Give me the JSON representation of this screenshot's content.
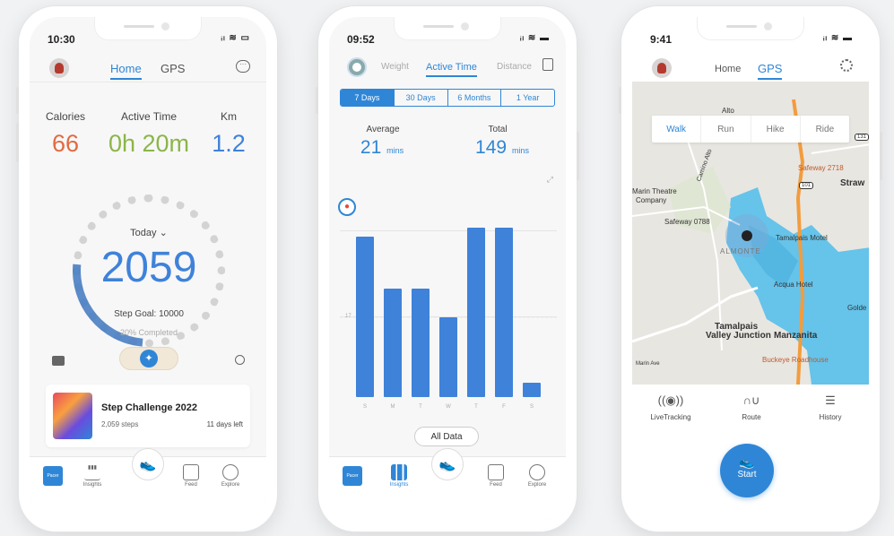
{
  "colors": {
    "accent": "#2f86d6",
    "calories": "#e16a40",
    "active_time": "#8cb54a",
    "km": "#3f82d9",
    "bar": "#3f82d9"
  },
  "phone1": {
    "status": {
      "time": "10:30",
      "icons": "ᵢₗ ≋ ▭"
    },
    "tabs": [
      "Home",
      "GPS"
    ],
    "metrics": [
      {
        "label": "Calories",
        "value": "66"
      },
      {
        "label": "Active Time",
        "value": "0h 20m"
      },
      {
        "label": "Km",
        "value": "1.2"
      }
    ],
    "day_selector": "Today ⌄",
    "steps": "2059",
    "step_goal": "Step Goal: 10000",
    "completed": "20% Completed",
    "progress_fraction": 0.2,
    "challenge": {
      "title": "Step Challenge 2022",
      "steps": "2,059 steps",
      "days_left": "11 days left"
    },
    "nav": {
      "logo": "Pacer",
      "insights": "Insights",
      "feed": "Feed",
      "explore": "Explore"
    }
  },
  "phone2": {
    "status": {
      "time": "09:52",
      "icons": "ᵢₗ ≋ ▬"
    },
    "tabs": [
      "Weight",
      "Active Time",
      "Distance"
    ],
    "ranges": [
      "7 Days",
      "30 Days",
      "6 Months",
      "1 Year"
    ],
    "average_label": "Average",
    "average_value": "21",
    "total_label": "Total",
    "total_value": "149",
    "unit": "mins",
    "y_marker": "17",
    "all_data": "All Data",
    "nav": {
      "logo": "Pacer",
      "insights": "Insights",
      "feed": "Feed",
      "explore": "Explore"
    }
  },
  "chart_data": {
    "type": "bar",
    "categories": [
      "S",
      "M",
      "T",
      "W",
      "T",
      "F",
      "S"
    ],
    "values": [
      34,
      23,
      23,
      17,
      36,
      36,
      3
    ],
    "ylabel": "",
    "reference_line": 17
  },
  "phone3": {
    "status": {
      "time": "9:41",
      "icons": "ᵢₗ ≋ ▬"
    },
    "tabs": [
      "Home",
      "GPS"
    ],
    "modes": [
      "Walk",
      "Run",
      "Hike",
      "Ride"
    ],
    "map_labels": {
      "alto": "Alto",
      "safeway1": "Safeway 2718",
      "theatre": "Marin Theatre",
      "company": "Company",
      "safeway2": "Safeway 0788",
      "strawberry": "Straw",
      "almonte": "ALMONTE",
      "motel": "Tamalpais Motel",
      "acqua": "Acqua Hotel",
      "goldentheo": "Golde",
      "tamalpais": "Tamalpais",
      "valley": "Valley Junction",
      "manzanita": "Manzanita",
      "buckeye": "Buckeye Roadhouse",
      "marinave": "Marin Ave",
      "camino": "Camino Alto",
      "route101": "101",
      "route131": "131"
    },
    "actions": [
      "LiveTracking",
      "Route",
      "History"
    ],
    "start": "Start"
  }
}
